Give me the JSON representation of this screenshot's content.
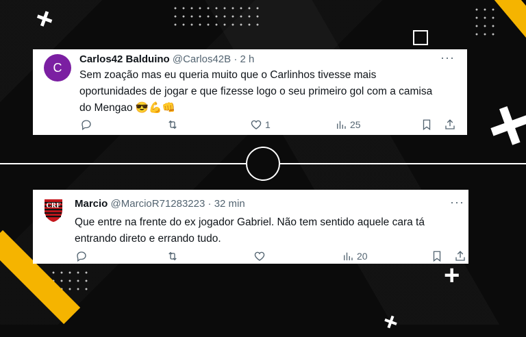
{
  "tweets": [
    {
      "avatar_letter": "C",
      "avatar_color": "#7b1fa2",
      "name": "Carlos42 Balduino",
      "handle": "@Carlos42B",
      "separator": "·",
      "time": "2 h",
      "text_line1": "Sem zoação mas eu queria muito que o Carlinhos tivesse mais",
      "text_line2": "oportunidades de jogar e que fizesse logo o seu primeiro gol com a camisa",
      "text_line3": "do Mengao 😎💪👊",
      "likes": "1",
      "views": "25"
    },
    {
      "name": "Marcio",
      "handle": "@MarcioR71283223",
      "separator": "·",
      "time": "32 min",
      "text_line1": "Que entre na frente do ex jogador Gabriel. Não tem sentido aquele cara tá",
      "text_line2": "entrando direto e errando tudo.",
      "views": "20"
    }
  ],
  "more_symbol": "···",
  "colors": {
    "accent_yellow": "#f5b400",
    "background": "#0b0b0b",
    "text": "#0f1419",
    "muted": "#536471",
    "flamengo_red": "#c4161c"
  }
}
